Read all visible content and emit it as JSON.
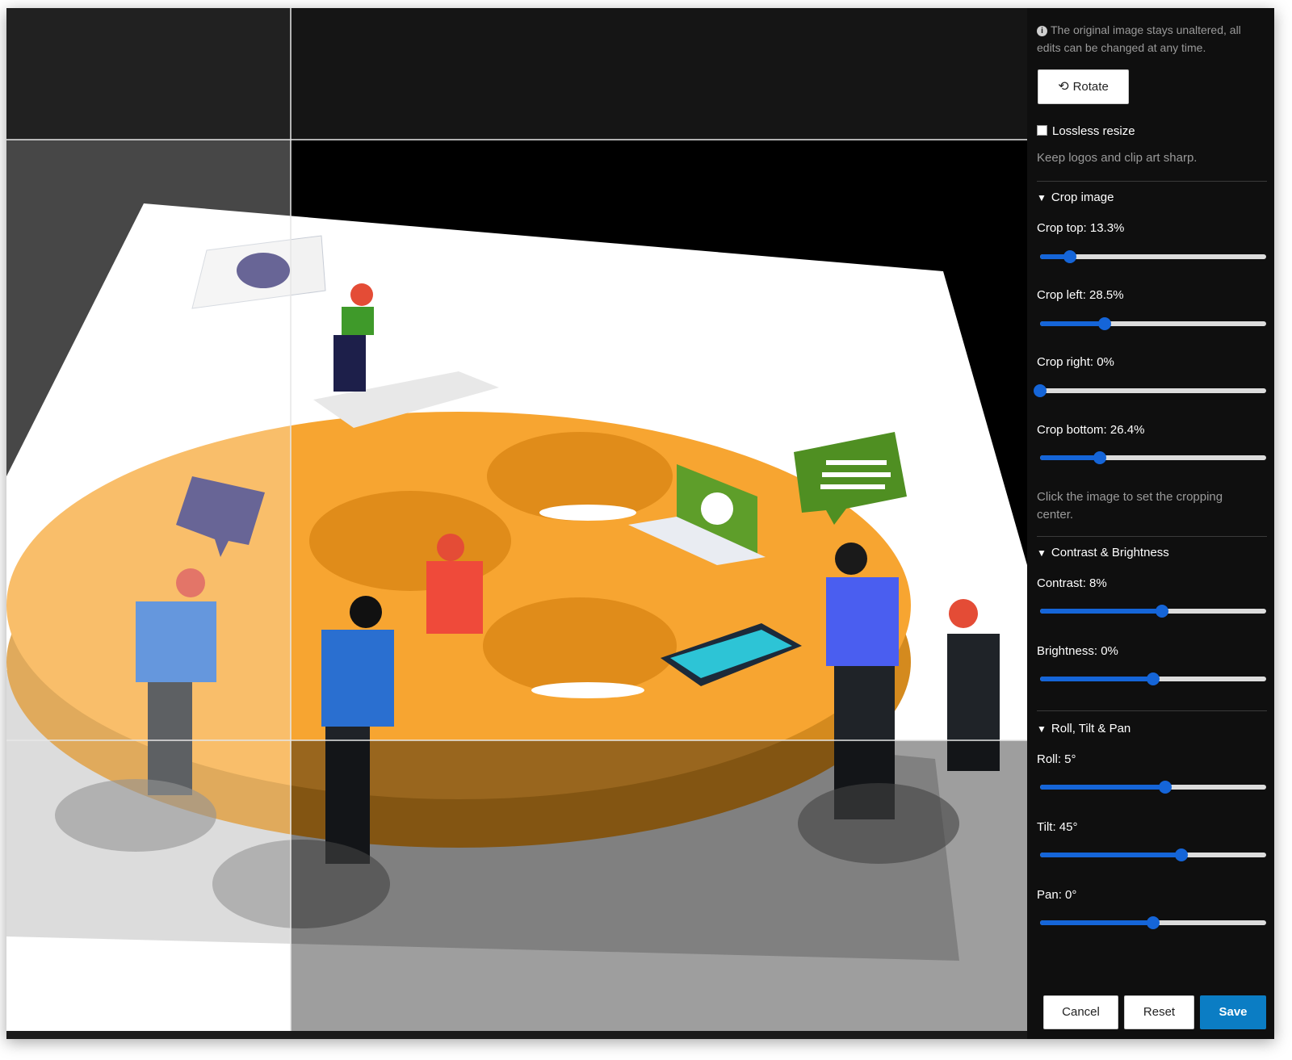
{
  "notice": {
    "text": "The original image stays unaltered, all edits can be changed at any time."
  },
  "rotate": {
    "label": "Rotate",
    "icon": "rotate-icon"
  },
  "lossless": {
    "label": "Lossless resize",
    "checked": false,
    "help": "Keep logos and clip art sharp."
  },
  "crop": {
    "title": "Crop image",
    "top": {
      "label": "Crop top: 13.3%",
      "value": 0.133
    },
    "left": {
      "label": "Crop left: 28.5%",
      "value": 0.285
    },
    "right": {
      "label": "Crop right: 0%",
      "value": 0
    },
    "bottom": {
      "label": "Crop bottom: 26.4%",
      "value": 0.264
    },
    "hint": "Click the image to set the cropping center."
  },
  "contrast_brightness": {
    "title": "Contrast & Brightness",
    "contrast": {
      "label": "Contrast: 8%",
      "value": 0.54
    },
    "brightness": {
      "label": "Brightness: 0%",
      "value": 0.5
    }
  },
  "roll_tilt_pan": {
    "title": "Roll, Tilt & Pan",
    "roll": {
      "label": "Roll: 5°",
      "value": 0.555
    },
    "tilt": {
      "label": "Tilt: 45°",
      "value": 0.625
    },
    "pan": {
      "label": "Pan: 0°",
      "value": 0.5
    }
  },
  "buttons": {
    "cancel": "Cancel",
    "reset": "Reset",
    "save": "Save"
  },
  "colors": {
    "accent": "#1565d8",
    "save": "#0b7dc4",
    "panel": "#0f0f0f",
    "canvas_bg": "#000000",
    "illustration_orange": "#f7a531"
  }
}
